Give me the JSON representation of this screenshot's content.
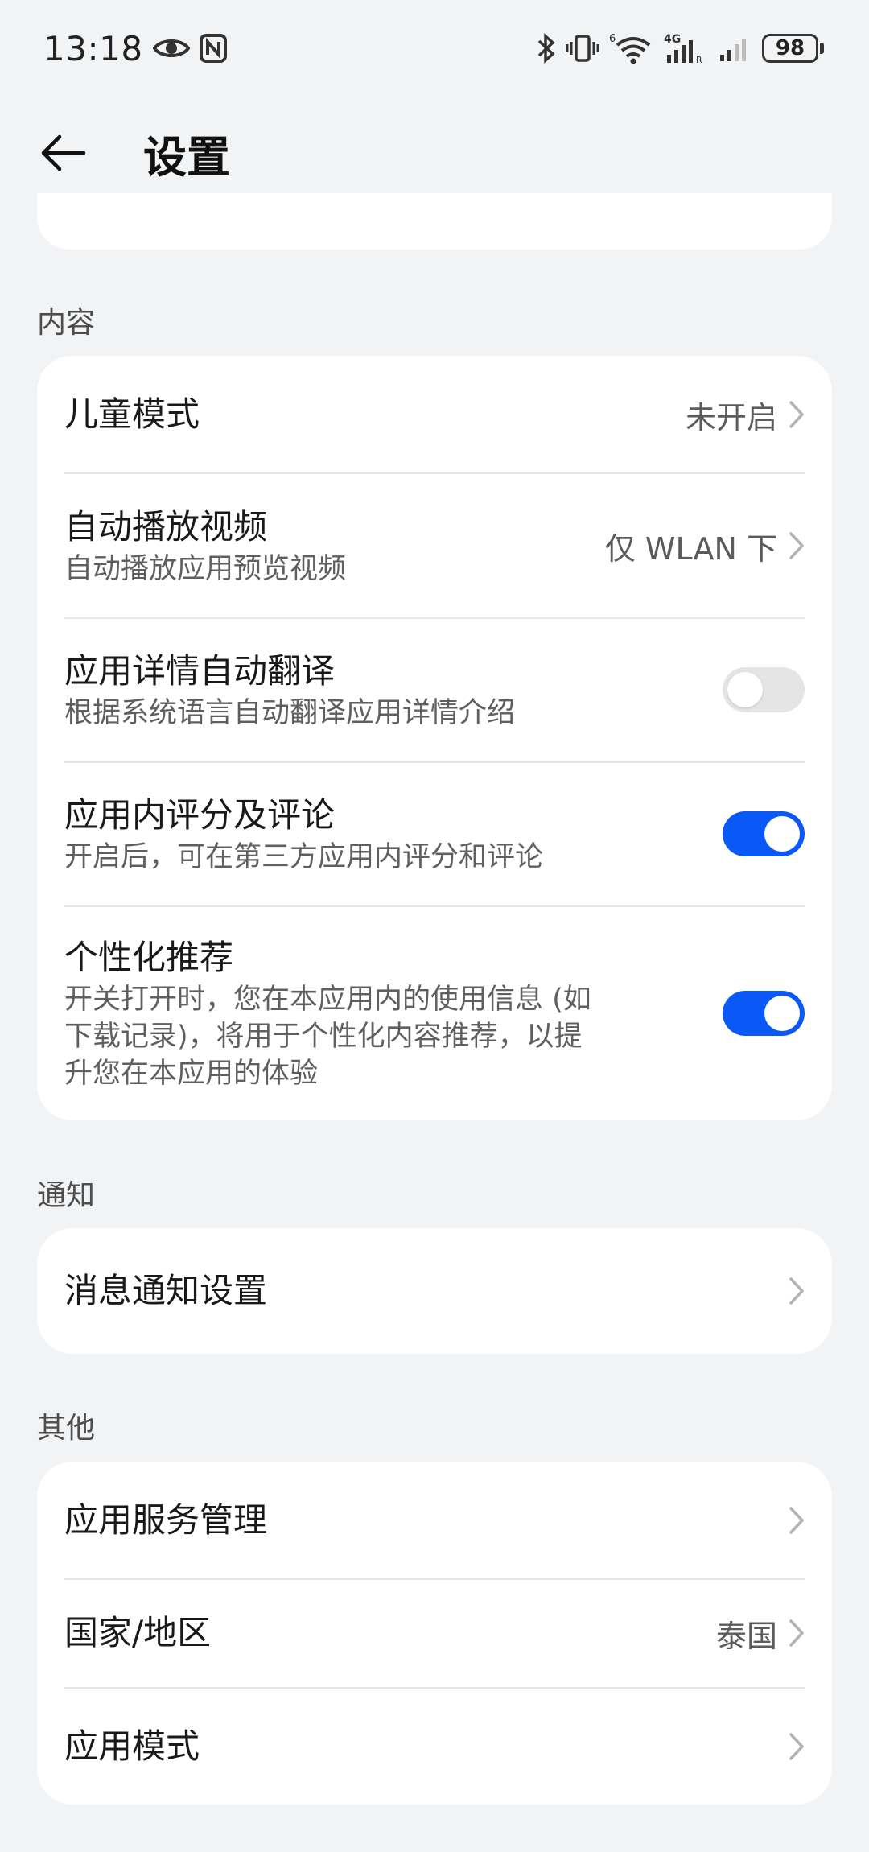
{
  "status_bar": {
    "time": "13:18",
    "network": "4G",
    "wifi_badge": "6",
    "battery": "98"
  },
  "header": {
    "title": "设置"
  },
  "sections": {
    "content": {
      "header": "内容",
      "items": [
        {
          "title": "儿童模式",
          "value": "未开启"
        },
        {
          "title": "自动播放视频",
          "subtitle": "自动播放应用预览视频",
          "value": "仅 WLAN 下"
        },
        {
          "title": "应用详情自动翻译",
          "subtitle": "根据系统语言自动翻译应用详情介绍",
          "toggle_on": false
        },
        {
          "title": "应用内评分及评论",
          "subtitle": "开启后，可在第三方应用内评分和评论",
          "toggle_on": true
        },
        {
          "title": "个性化推荐",
          "subtitle_lines": [
            "开关打开时，您在本应用内的使用信息 (如",
            "下载记录)，将用于个性化内容推荐，以提",
            "升您在本应用的体验"
          ],
          "toggle_on": true
        }
      ]
    },
    "notification": {
      "header": "通知",
      "items": [
        {
          "title": "消息通知设置"
        }
      ]
    },
    "other": {
      "header": "其他",
      "items": [
        {
          "title": "应用服务管理"
        },
        {
          "title": "国家/地区",
          "value": "泰国"
        },
        {
          "title": "应用模式"
        }
      ]
    }
  },
  "colors": {
    "background": "#f1f3f5",
    "card": "#ffffff",
    "accent": "#0a59f7",
    "toggle_off": "#e5e5e5"
  }
}
